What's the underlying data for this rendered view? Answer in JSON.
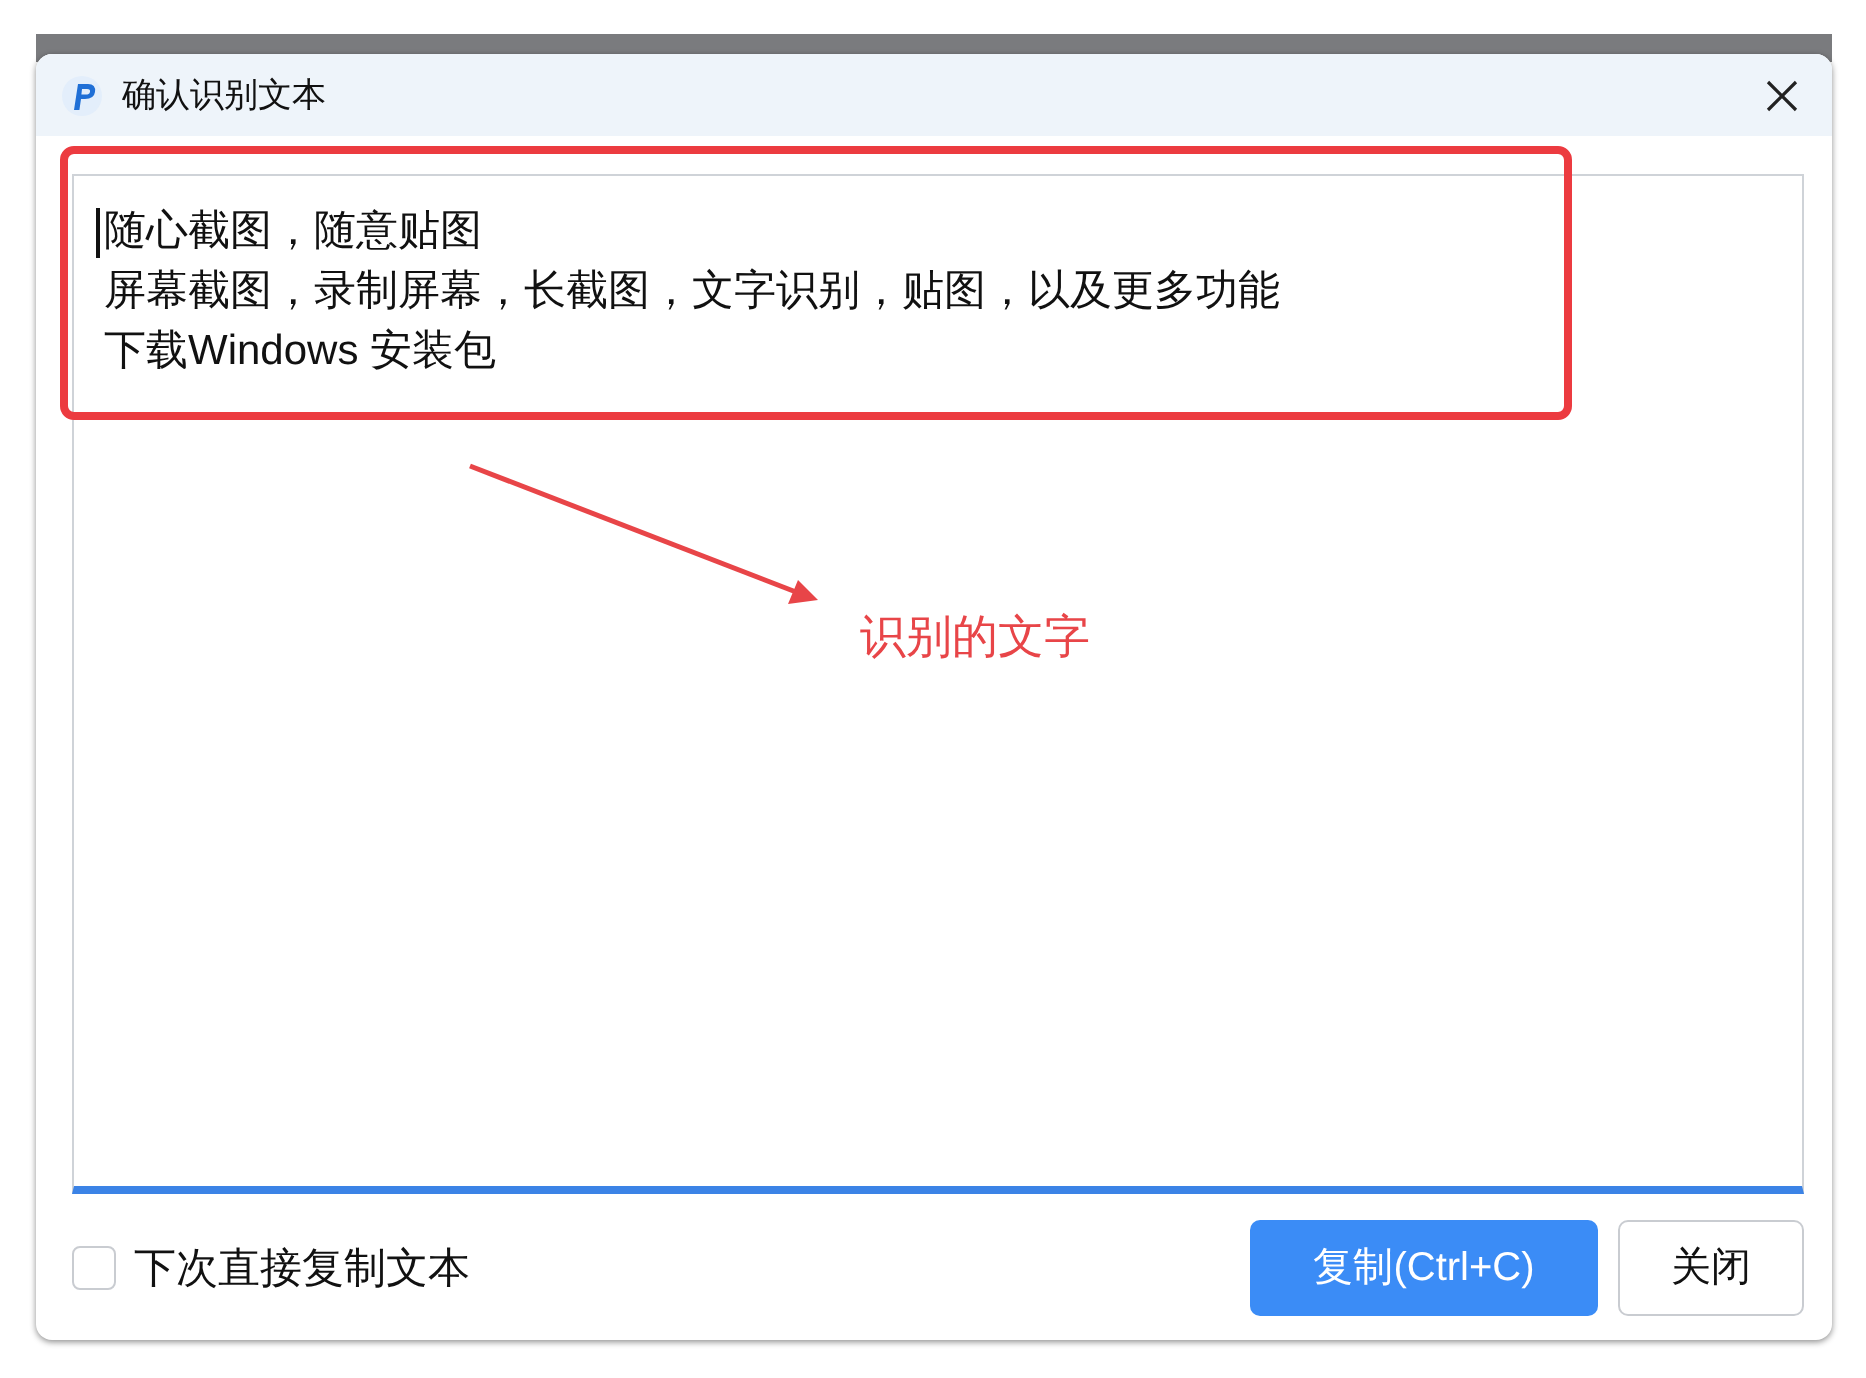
{
  "window": {
    "title": "确认识别文本"
  },
  "recognized_text": {
    "lines": [
      "随心截图，随意贴图",
      "屏幕截图，录制屏幕，长截图，文字识别，贴图，以及更多功能",
      "下载Windows 安装包"
    ],
    "cursor": true
  },
  "annotation": {
    "label": "识别的文字"
  },
  "copy_directly_checkbox": {
    "label": "下次直接复制文本",
    "checked": false
  },
  "buttons": [
    {
      "label": "复制(Ctrl+C)",
      "kind": "primary"
    },
    {
      "label": "关闭",
      "kind": "default"
    }
  ]
}
